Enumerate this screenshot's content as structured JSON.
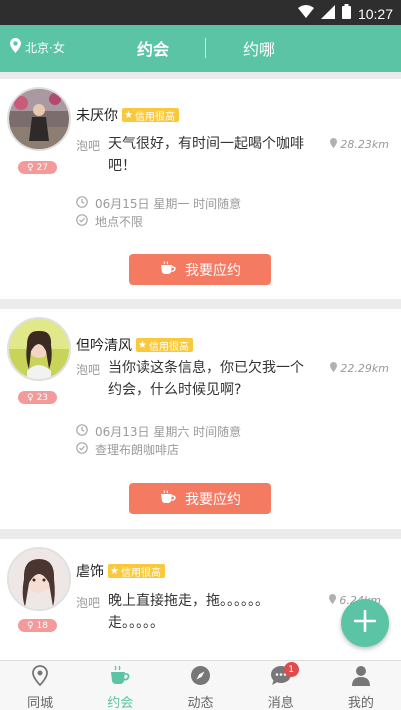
{
  "status_bar": {
    "time": "10:27"
  },
  "header": {
    "location": "北京·女",
    "tabs": [
      {
        "label": "约会",
        "active": true
      },
      {
        "label": "约哪",
        "active": false
      }
    ]
  },
  "cards": [
    {
      "nickname": "未厌你",
      "credit": "信用很高",
      "age": "27",
      "category": "泡吧",
      "message": "天气很好，有时间一起喝个咖啡吧！",
      "distance": "28.23km",
      "date": "06月15日 星期一 时间随意",
      "place": "地点不限",
      "button": "我要应约"
    },
    {
      "nickname": "但吟清风",
      "credit": "信用很高",
      "age": "23",
      "category": "泡吧",
      "message": "当你读这条信息，你已欠我一个约会，什么时候见啊?",
      "distance": "22.29km",
      "date": "06月13日 星期六 时间随意",
      "place": "查理布朗咖啡店",
      "button": "我要应约"
    },
    {
      "nickname": "虐饰",
      "credit": "信用很高",
      "age": "18",
      "category": "泡吧",
      "message": "晚上直接拖走，拖。。。。。。走。。。。。",
      "distance": "6.24km"
    }
  ],
  "bottom_nav": [
    {
      "label": "同城",
      "icon": "location-icon",
      "active": false
    },
    {
      "label": "约会",
      "icon": "coffee-icon",
      "active": true
    },
    {
      "label": "动态",
      "icon": "compass-icon",
      "active": false
    },
    {
      "label": "消息",
      "icon": "chat-icon",
      "active": false,
      "badge": "1"
    },
    {
      "label": "我的",
      "icon": "person-icon",
      "active": false
    }
  ],
  "colors": {
    "accent": "#5bc4a5",
    "button": "#f47a62",
    "credit": "#f9c93b",
    "age_badge": "#f49a9a"
  }
}
